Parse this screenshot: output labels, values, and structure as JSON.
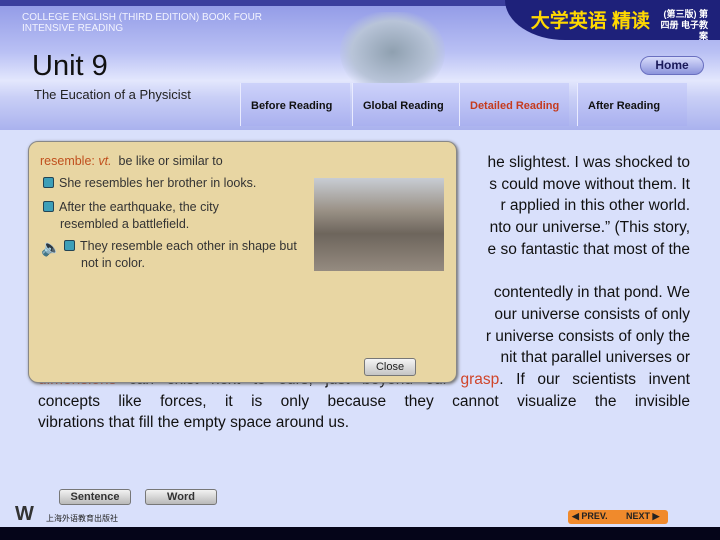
{
  "header": {
    "course": "COLLEGE ENGLISH (THIRD EDITION) BOOK FOUR INTENSIVE READING",
    "brand": "大学英语 精读",
    "brand_sub": "(第三版) 第四册 电子教案",
    "unit": "Unit 9",
    "subtitle": "The Eucation of a Physicist",
    "home": "Home"
  },
  "tabs": [
    {
      "label": "Before Reading"
    },
    {
      "label": "Global Reading"
    },
    {
      "label": "Detailed Reading",
      "active": true
    },
    {
      "label": "After Reading"
    }
  ],
  "passage": {
    "lines": [
      "he slightest. I was shocked to",
      "s could move without them. It",
      "r applied in this other world.",
      "nto our universe.” (This story,",
      "e so fantastic that most of the",
      "contentedly in that pond. We",
      "our universe consists of only",
      "r universe consists of only the",
      "nit that parallel universes or"
    ],
    "line10": {
      "w1": "dimensions",
      "mid": " can exist next to ours, just beyond our ",
      "w2": "grasp",
      "end": ". If our scientists invent"
    },
    "line11": "concepts like forces, it is only because they cannot visualize the invisible",
    "line12": "vibrations that fill the empty space around us."
  },
  "popup": {
    "word": "resemble:",
    "pos": "vt.",
    "definition": "be like or similar to",
    "examples": [
      "She resembles her brother in looks.",
      "After the earthquake, the city resembled a battlefield.",
      "They resemble each other in shape but not in color."
    ],
    "close": "Close"
  },
  "footer": {
    "sentence": "Sentence",
    "word": "Word",
    "publisher": "上海外语教育出版社",
    "prev": "PREV.",
    "next": "NEXT"
  },
  "colors": {
    "accent": "#d0452a",
    "popup_bg": "#e8d6a3",
    "nav": "#f08a2c"
  }
}
